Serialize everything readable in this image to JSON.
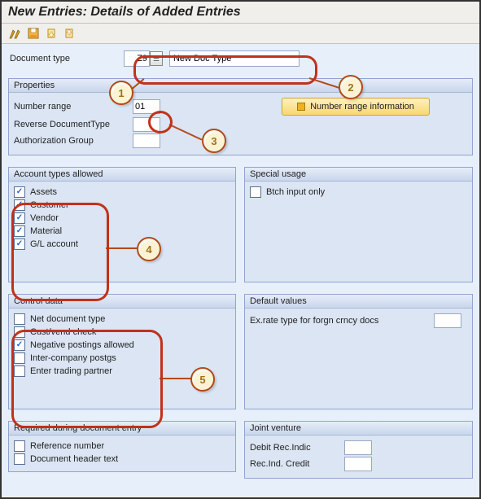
{
  "page_title": "New Entries: Details of Added Entries",
  "doc_type": {
    "label": "Document type",
    "value": "Z9",
    "desc": "New Doc Type"
  },
  "properties": {
    "header": "Properties",
    "number_range": {
      "label": "Number range",
      "value": "01"
    },
    "reverse_doc_type": {
      "label": "Reverse DocumentType",
      "value": ""
    },
    "auth_group": {
      "label": "Authorization Group",
      "value": ""
    },
    "button": "Number range information"
  },
  "account_types": {
    "header": "Account types allowed",
    "items": [
      {
        "label": "Assets",
        "checked": true
      },
      {
        "label": "Customer",
        "checked": true
      },
      {
        "label": "Vendor",
        "checked": true
      },
      {
        "label": "Material",
        "checked": true
      },
      {
        "label": "G/L account",
        "checked": true
      }
    ]
  },
  "special_usage": {
    "header": "Special usage",
    "items": [
      {
        "label": "Btch input only",
        "checked": false
      }
    ]
  },
  "control_data": {
    "header": "Control data",
    "items": [
      {
        "label": "Net document type",
        "checked": false
      },
      {
        "label": "Cust/vend check",
        "checked": false
      },
      {
        "label": "Negative postings allowed",
        "checked": true
      },
      {
        "label": "Inter-company postgs",
        "checked": false
      },
      {
        "label": "Enter trading partner",
        "checked": false
      }
    ]
  },
  "default_values": {
    "header": "Default values",
    "ex_rate": {
      "label": "Ex.rate type for forgn crncy docs",
      "value": ""
    }
  },
  "required_entry": {
    "header": "Required during document entry",
    "items": [
      {
        "label": "Reference number",
        "checked": false
      },
      {
        "label": "Document header text",
        "checked": false
      }
    ]
  },
  "joint_venture": {
    "header": "Joint venture",
    "debit": {
      "label": "Debit Rec.Indic",
      "value": ""
    },
    "credit": {
      "label": "Rec.Ind. Credit",
      "value": ""
    }
  },
  "callouts": {
    "c1": "1",
    "c2": "2",
    "c3": "3",
    "c4": "4",
    "c5": "5"
  }
}
